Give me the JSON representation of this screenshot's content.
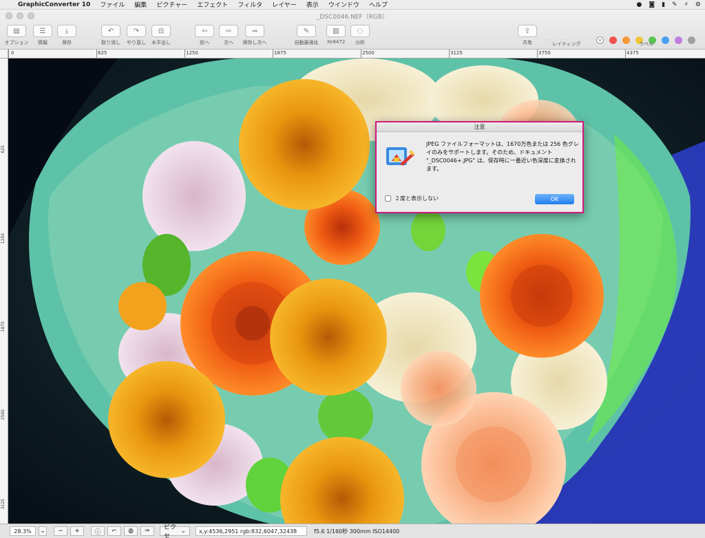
{
  "menubar": {
    "app_name": "GraphicConverter 10",
    "items": [
      "ファイル",
      "編集",
      "ピクチャー",
      "エフェクト",
      "フィルタ",
      "レイヤー",
      "表示",
      "ウインドウ",
      "ヘルプ"
    ]
  },
  "window": {
    "title": "_DSC0046.NEF（RGB）"
  },
  "toolbar": {
    "buttons": [
      {
        "label": "オプション",
        "icon": "options-icon"
      },
      {
        "label": "情報",
        "icon": "info-icon"
      },
      {
        "label": "保存",
        "icon": "save-icon"
      },
      {
        "label": "取り消し",
        "icon": "undo-icon"
      },
      {
        "label": "やり直し",
        "icon": "redo-icon"
      },
      {
        "label": "水平出し",
        "icon": "level-icon"
      },
      {
        "label": "前へ",
        "icon": "prev-icon"
      },
      {
        "label": "次へ",
        "icon": "next-icon"
      },
      {
        "label": "保存し次へ",
        "icon": "save-next-icon"
      },
      {
        "label": "自動最適化",
        "icon": "auto-enhance-icon"
      },
      {
        "label": "Xe8472",
        "icon": "image-icon"
      },
      {
        "label": "分析",
        "icon": "analyze-icon"
      },
      {
        "label": "共有",
        "icon": "share-icon"
      }
    ],
    "rating_label": "レイティング",
    "label_label": "ラベル",
    "label_colors": [
      "#f0524f",
      "#f59a3a",
      "#f2c73c",
      "#5cc455",
      "#4aa0f0",
      "#c27ede",
      "#a0a0a0"
    ]
  },
  "ruler": {
    "h_ticks": [
      "0",
      "625",
      "1250",
      "1875",
      "2500",
      "3125",
      "3750",
      "4375"
    ],
    "v_ticks": [
      "625",
      "1250",
      "1875",
      "2500",
      "3125"
    ]
  },
  "dialog": {
    "title": "注意",
    "message": "JPEG ファイルフォーマットは、1670万色または 256 色グレイのみをサポートします。そのため、ドキュメント \"_DSC0046+.JPG\" は、保存時に一番近い色深度に変換されます。",
    "checkbox_label": "２度と表示しない",
    "ok_label": "OK"
  },
  "statusbar": {
    "zoom": "28.3%",
    "mode": "ピクセ",
    "coords": "x,y:4536,2951 rgb:832,6047,32438",
    "exif": "f5.6 1/160秒 300mm ISO14400"
  }
}
